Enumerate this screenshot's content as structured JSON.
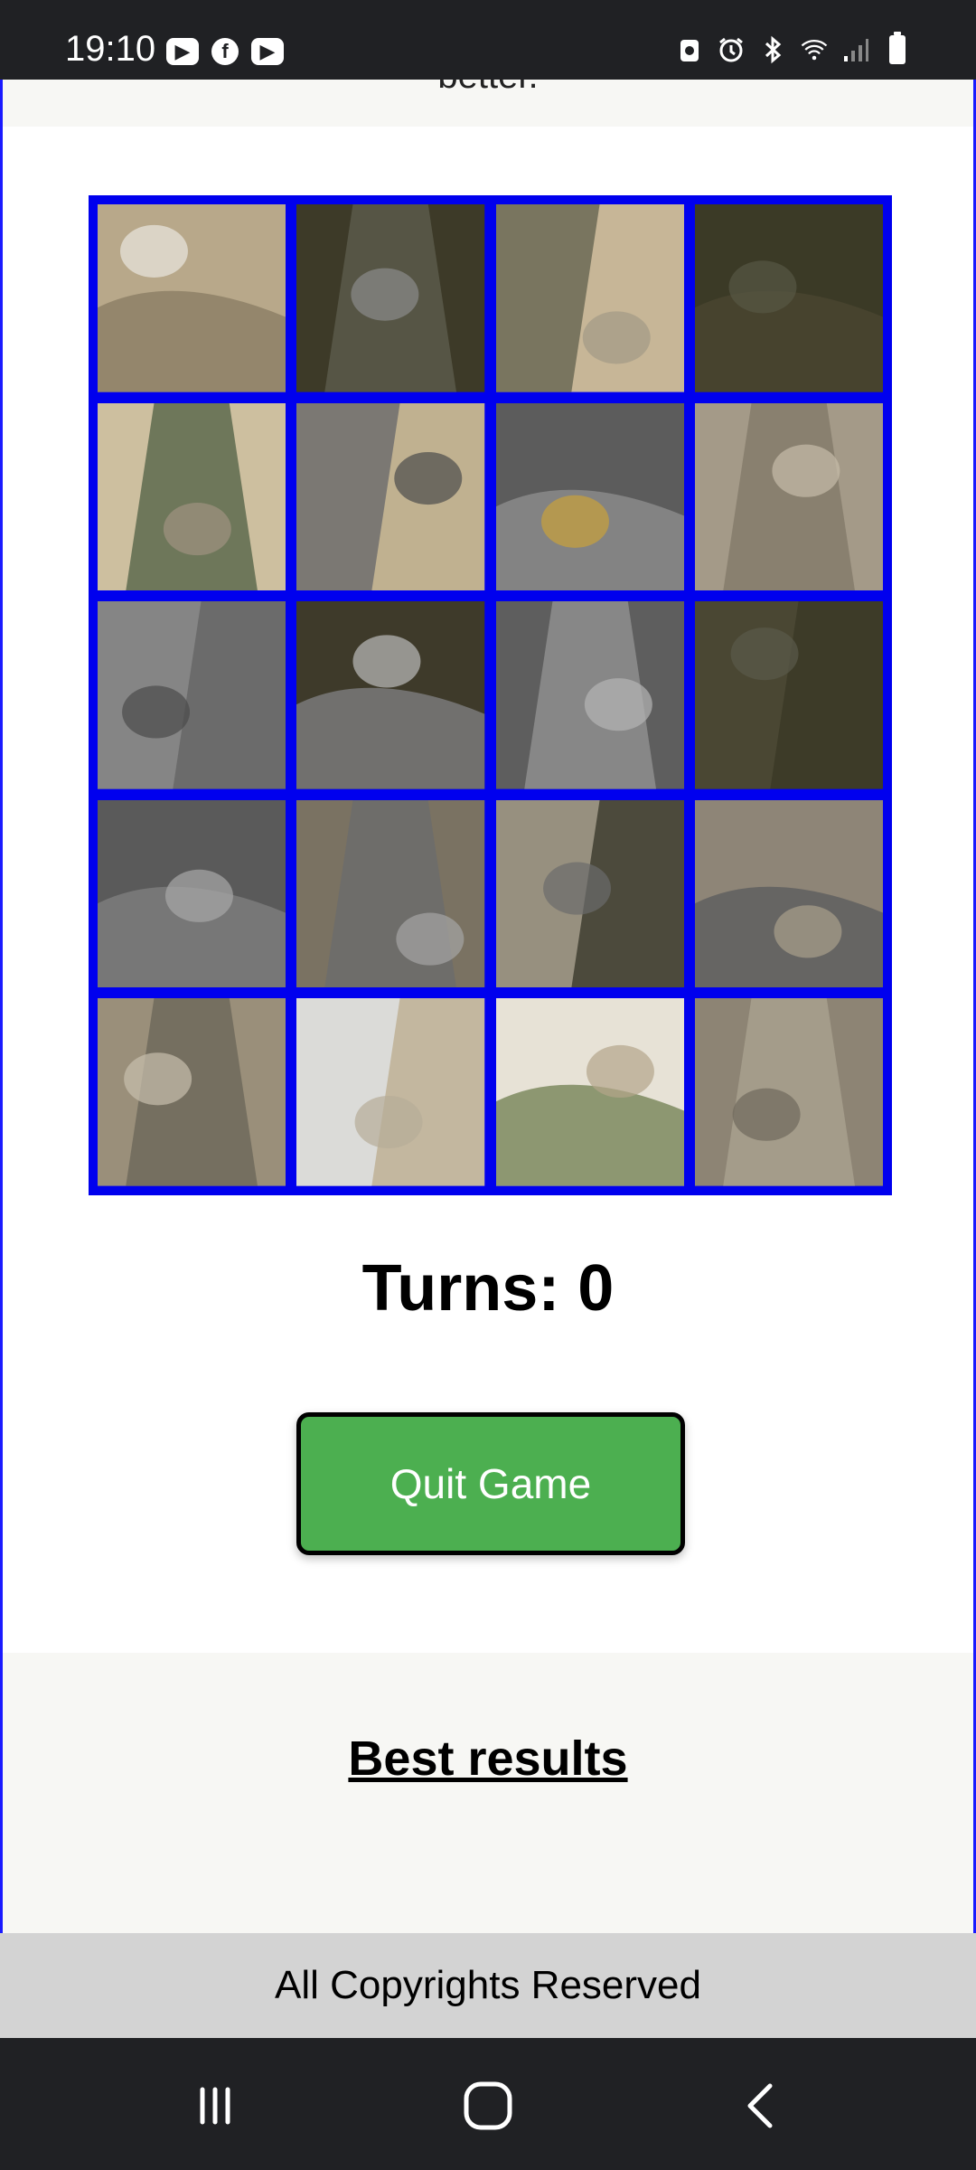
{
  "status_bar": {
    "time": "19:10",
    "app_icons": [
      "youtube-icon",
      "facebook-icon",
      "youtube-icon"
    ],
    "right_icons": [
      "charging-icon",
      "alarm-icon",
      "bluetooth-icon",
      "wifi-icon",
      "signal-icon",
      "battery-icon"
    ]
  },
  "page": {
    "cut_text": "better.",
    "turns_label": "Turns: 0",
    "quit_button": "Quit Game",
    "best_results_title": "Best results",
    "footer_text": "All Copyrights Reserved"
  },
  "puzzle": {
    "rows": 5,
    "cols": 4,
    "border_color": "#0000ee"
  },
  "colors": {
    "quit_button_bg": "#4caf50",
    "band_bg": "#f7f7f4",
    "footer_bg": "#d3d3d3",
    "system_bar_bg": "#202124"
  },
  "nav_bar": {
    "buttons": [
      "recent-apps-icon",
      "home-icon",
      "back-icon"
    ]
  }
}
